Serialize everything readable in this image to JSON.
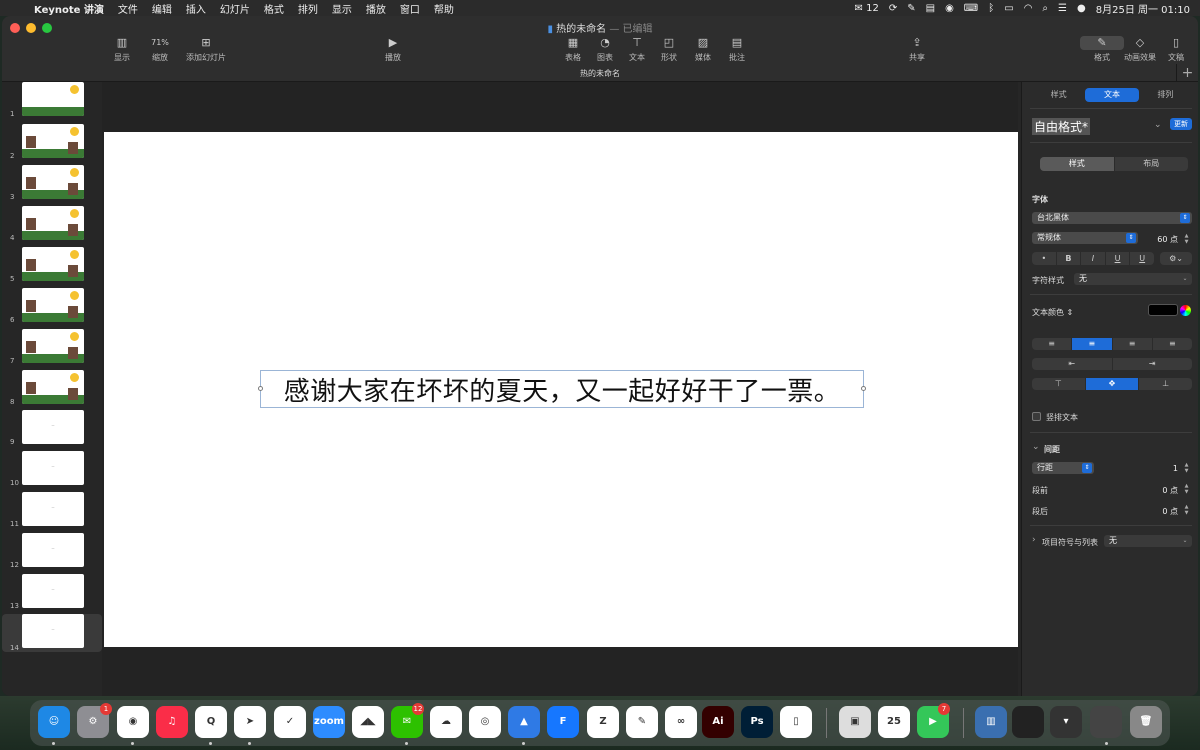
{
  "menubar": {
    "app_name": "Keynote 讲演",
    "items": [
      "文件",
      "编辑",
      "插入",
      "幻灯片",
      "格式",
      "排列",
      "显示",
      "播放",
      "窗口",
      "帮助"
    ],
    "status_wechat_count": "12",
    "datetime": "8月25日 周一 01:10"
  },
  "window": {
    "title": "热的未命名",
    "edited": "— 已编辑",
    "subtitle": "热的未命名",
    "traffic_colors": [
      "#ff5f57",
      "#febc2e",
      "#28c840"
    ]
  },
  "toolbar": {
    "view_label": "显示",
    "zoom_value": "71%",
    "zoom_label": "缩放",
    "add_slide_label": "添加幻灯片",
    "play_label": "播放",
    "table_label": "表格",
    "chart_label": "图表",
    "text_label": "文本",
    "shape_label": "形状",
    "media_label": "媒体",
    "comment_label": "批注",
    "share_label": "共享",
    "format_label": "格式",
    "animate_label": "动画效果",
    "document_label": "文稿"
  },
  "navigator": {
    "slides": [
      {
        "num": "1"
      },
      {
        "num": "2"
      },
      {
        "num": "3"
      },
      {
        "num": "4"
      },
      {
        "num": "5"
      },
      {
        "num": "6"
      },
      {
        "num": "7"
      },
      {
        "num": "8"
      },
      {
        "num": "9"
      },
      {
        "num": "10"
      },
      {
        "num": "11"
      },
      {
        "num": "12"
      },
      {
        "num": "13"
      },
      {
        "num": "14"
      }
    ]
  },
  "slide": {
    "text": "感谢大家在坏坏的夏天，又一起好好干了一票。"
  },
  "inspector": {
    "tabs": [
      "样式",
      "文本",
      "排列"
    ],
    "active_tab": "文本",
    "paragraph_style": "自由格式*",
    "update_label": "更新",
    "style_layout": [
      "样式",
      "布局"
    ],
    "font_heading": "字体",
    "font_family": "台北黑体",
    "font_weight": "常规体",
    "font_size": "60 点",
    "bold_label": "B",
    "italic_label": "I",
    "underline_label": "U",
    "strike_label": "U",
    "char_style_label": "字符样式",
    "char_style_value": "无",
    "text_color_label": "文本颜色",
    "text_color": "#000000",
    "vertical_text_label": "竖排文本",
    "spacing_label": "间距",
    "line_spacing_mode": "行距",
    "line_spacing_value": "1",
    "before_label": "段前",
    "before_value": "0 点",
    "after_label": "段后",
    "after_value": "0 点",
    "bullets_label": "项目符号与列表",
    "bullets_value": "无"
  },
  "dock": {
    "apps": [
      {
        "name": "Finder",
        "color": "#1e88e5",
        "glyph": "☺"
      },
      {
        "name": "System Settings",
        "color": "#8e8e93",
        "glyph": "⚙"
      },
      {
        "name": "Chrome",
        "color": "#ffffff",
        "glyph": "◉"
      },
      {
        "name": "Music",
        "color": "#fa2d48",
        "glyph": "♫"
      },
      {
        "name": "QQ",
        "color": "#ffffff",
        "glyph": "Q"
      },
      {
        "name": "Feishu",
        "color": "#ffffff",
        "glyph": "➤"
      },
      {
        "name": "Lark",
        "color": "#ffffff",
        "glyph": "✓"
      },
      {
        "name": "Zoom",
        "color": "#2d8cff",
        "glyph": "zoom"
      },
      {
        "name": "Tencent Meeting",
        "color": "#ffffff",
        "glyph": "◢◣"
      },
      {
        "name": "WeChat",
        "color": "#2dc100",
        "glyph": "✉"
      },
      {
        "name": "Baidu Netdisk",
        "color": "#ffffff",
        "glyph": "☁"
      },
      {
        "name": "Tencent Docs",
        "color": "#ffffff",
        "glyph": "◎"
      },
      {
        "name": "Keynote",
        "color": "#2f7ae5",
        "glyph": "▲"
      },
      {
        "name": "Feishu Docs",
        "color": "#1677ff",
        "glyph": "F"
      },
      {
        "name": "Zotero",
        "color": "#ffffff",
        "glyph": "Z"
      },
      {
        "name": "Pen",
        "color": "#ffffff",
        "glyph": "✎"
      },
      {
        "name": "Creative Cloud",
        "color": "#ffffff",
        "glyph": "∞"
      },
      {
        "name": "Illustrator",
        "color": "#330000",
        "glyph": "Ai"
      },
      {
        "name": "Photoshop",
        "color": "#001e36",
        "glyph": "Ps"
      },
      {
        "name": "iPhone Mirroring",
        "color": "#ffffff",
        "glyph": "▯"
      },
      {
        "name": "Preview",
        "color": "#dddddd",
        "glyph": "▣"
      },
      {
        "name": "Calendar",
        "color": "#ffffff",
        "glyph": "25"
      },
      {
        "name": "FaceTime",
        "color": "#34c759",
        "glyph": "▶"
      }
    ],
    "calendar_month": "8月",
    "calendar_day": "25",
    "badges": {
      "settings": "1",
      "wechat": "12",
      "facetime": "7"
    }
  }
}
